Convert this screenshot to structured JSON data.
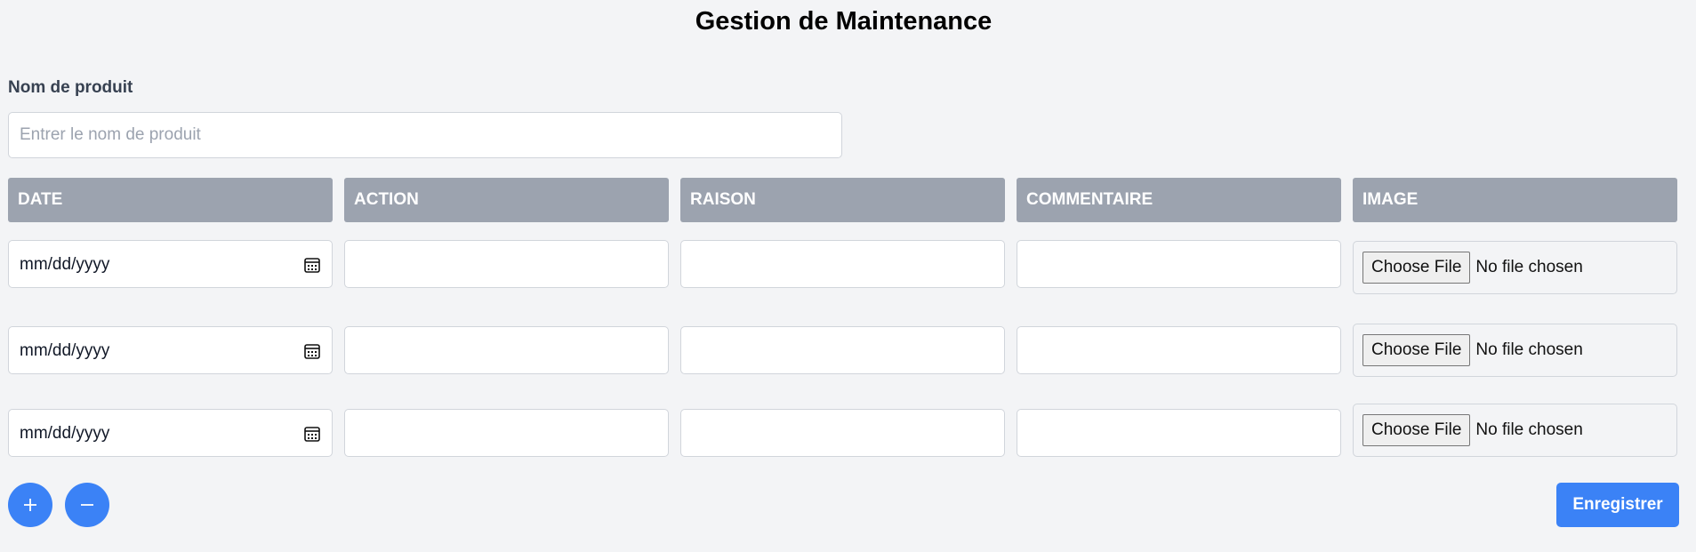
{
  "page": {
    "title": "Gestion de Maintenance"
  },
  "product": {
    "label": "Nom de produit",
    "placeholder": "Entrer le nom de produit",
    "value": ""
  },
  "table": {
    "headers": [
      "DATE",
      "ACTION",
      "RAISON",
      "COMMENTAIRE",
      "IMAGE"
    ],
    "rows": [
      {
        "date": "mm/dd/yyyy",
        "action": "",
        "raison": "",
        "commentaire": "",
        "image_button": "Choose File",
        "image_status": "No file chosen"
      },
      {
        "date": "mm/dd/yyyy",
        "action": "",
        "raison": "",
        "commentaire": "",
        "image_button": "Choose File",
        "image_status": "No file chosen"
      },
      {
        "date": "mm/dd/yyyy",
        "action": "",
        "raison": "",
        "commentaire": "",
        "image_button": "Choose File",
        "image_status": "No file chosen"
      }
    ]
  },
  "actions": {
    "add_row_icon": "plus-icon",
    "remove_row_icon": "minus-icon",
    "save_label": "Enregistrer"
  },
  "colors": {
    "accent": "#3b82f6",
    "header_bg": "#9ca3af",
    "page_bg": "#f3f4f6"
  }
}
